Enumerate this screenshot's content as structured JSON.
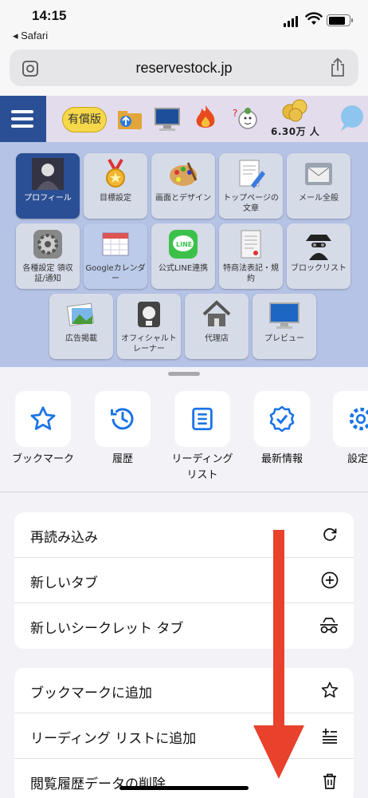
{
  "status": {
    "time": "14:15",
    "back_app": "◂ Safari"
  },
  "browser": {
    "url": "reservestock.jp"
  },
  "site": {
    "paid_badge": "有償版",
    "member_count": "6.30万 人",
    "tiles": [
      {
        "label": "プロフィール",
        "icon": "profile-photo-icon"
      },
      {
        "label": "目標設定",
        "icon": "medal-icon"
      },
      {
        "label": "画面とデザイン",
        "icon": "palette-icon"
      },
      {
        "label": "トップページの文章",
        "icon": "document-pen-icon"
      },
      {
        "label": "メール全般",
        "icon": "mail-icon"
      },
      {
        "label": "各種設定 領収証/通知",
        "icon": "gear-icon"
      },
      {
        "label": "Googleカレンダー",
        "icon": "calendar-icon"
      },
      {
        "label": "公式LINE連携",
        "icon": "line-icon"
      },
      {
        "label": "特商法表記・規約",
        "icon": "contract-icon"
      },
      {
        "label": "ブロックリスト",
        "icon": "spy-icon"
      },
      {
        "label": "広告掲載",
        "icon": "photo-icon"
      },
      {
        "label": "オフィシャルトレーナー",
        "icon": "trainer-icon"
      },
      {
        "label": "代理店",
        "icon": "house-icon"
      },
      {
        "label": "プレビュー",
        "icon": "monitor-icon"
      }
    ]
  },
  "sheet": {
    "quick_actions": [
      {
        "label": "ブックマーク",
        "icon": "star-icon"
      },
      {
        "label": "履歴",
        "icon": "history-icon"
      },
      {
        "label": "リーディングリスト",
        "icon": "reading-list-icon"
      },
      {
        "label": "最新情報",
        "icon": "badge-check-icon"
      },
      {
        "label": "設定",
        "icon": "gear-icon"
      }
    ],
    "group1": [
      {
        "label": "再読み込み",
        "icon": "reload-icon"
      },
      {
        "label": "新しいタブ",
        "icon": "plus-circle-icon"
      },
      {
        "label": "新しいシークレット タブ",
        "icon": "incognito-icon"
      }
    ],
    "group2": [
      {
        "label": "ブックマークに追加",
        "icon": "star-outline-icon"
      },
      {
        "label": "リーディング リストに追加",
        "icon": "add-list-icon"
      },
      {
        "label": "閲覧履歴データの削除",
        "icon": "trash-icon"
      }
    ]
  },
  "colors": {
    "accent": "#1a73e8",
    "arrow": "#e8412c",
    "site_bg": "#b5c3e6",
    "menu_bg": "#2a4f95"
  }
}
